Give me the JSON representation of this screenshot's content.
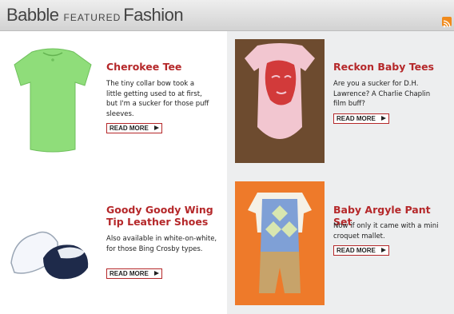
{
  "header": {
    "brand_part1": "Babble",
    "brand_part2": "FEATURED",
    "brand_part3": "Fashion",
    "feed_icon": "rss-feed-icon"
  },
  "items": [
    {
      "title": "Cherokee Tee",
      "description": "The tiny collar bow took a little getting used to at first, but I'm a sucker for those puff sleeves.",
      "read_more": "READ MORE",
      "photo": "green-puff-sleeve-tee"
    },
    {
      "title": "Reckon Baby Tees",
      "description": "Are you a sucker for D.H. Lawrence? A Charlie Chaplin film buff?",
      "read_more": "READ MORE",
      "photo": "pink-printed-baby-bodysuit"
    },
    {
      "title": "Goody Goody Wing Tip Leather Shoes",
      "description": "Also available in white-on-white, for those Bing Crosby types.",
      "read_more": "READ MORE",
      "photo": "white-and-navy-baby-shoes"
    },
    {
      "title": "Baby Argyle Pant Set",
      "description": "Now if only it came with a mini croquet mallet.",
      "read_more": "READ MORE",
      "photo": "argyle-vest-outfit"
    }
  ],
  "colors": {
    "title": "#b5282a",
    "header_bg": "#d9d9d9",
    "cell_grey": "#edeeef",
    "rss": "#f08a1c"
  }
}
